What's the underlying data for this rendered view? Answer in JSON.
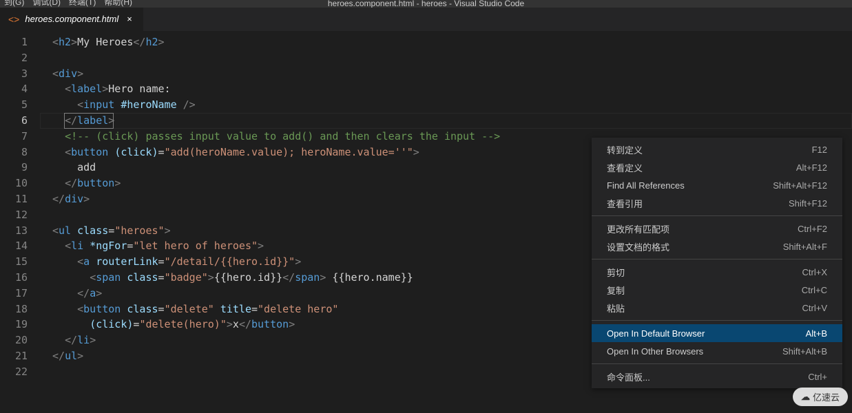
{
  "menu": {
    "m1": "到(G)",
    "m2": "调试(D)",
    "m3": "终端(T)",
    "m4": "帮助(H)"
  },
  "title": "heroes.component.html - heroes - Visual Studio Code",
  "tab": {
    "name": "heroes.component.html",
    "icon": "<>",
    "close": "×"
  },
  "lines": [
    "1",
    "2",
    "3",
    "4",
    "5",
    "6",
    "7",
    "8",
    "9",
    "10",
    "11",
    "12",
    "13",
    "14",
    "15",
    "16",
    "17",
    "18",
    "19",
    "20",
    "21",
    "22"
  ],
  "currentLine": "6",
  "code": {
    "l1_txt": "My Heroes",
    "l4_txt": "Hero name:",
    "l5_attr": "#heroName",
    "l7_c": "<!-- (click) passes input value to add() and then clears the input -->",
    "l8_ev": "(click)",
    "l8_val": "\"add(heroName.value); heroName.value=''\"",
    "l9": "add",
    "l13_a": "class",
    "l13_v": "\"heroes\"",
    "l14_a": "*ngFor",
    "l14_v": "\"let hero of heroes\"",
    "l15_a": "routerLink",
    "l15_v": "\"/detail/{{hero.id}}\"",
    "l16_a": "class",
    "l16_v": "\"badge\"",
    "l16_t1": "{{hero.id}}",
    "l16_t2": " {{hero.name}}",
    "l18_a1": "class",
    "l18_v1": "\"delete\"",
    "l18_a2": "title",
    "l18_v2": "\"delete hero\"",
    "l19_a": "(click)",
    "l19_v": "\"delete(hero)\"",
    "l19_t": "x"
  },
  "ctx": [
    {
      "l": "转到定义",
      "s": "F12"
    },
    {
      "l": "查看定义",
      "s": "Alt+F12"
    },
    {
      "l": "Find All References",
      "s": "Shift+Alt+F12"
    },
    {
      "l": "查看引用",
      "s": "Shift+F12"
    },
    {
      "sep": true
    },
    {
      "l": "更改所有匹配项",
      "s": "Ctrl+F2"
    },
    {
      "l": "设置文档的格式",
      "s": "Shift+Alt+F"
    },
    {
      "sep": true
    },
    {
      "l": "剪切",
      "s": "Ctrl+X"
    },
    {
      "l": "复制",
      "s": "Ctrl+C"
    },
    {
      "l": "粘贴",
      "s": "Ctrl+V"
    },
    {
      "sep": true
    },
    {
      "l": "Open In Default Browser",
      "s": "Alt+B",
      "sel": true
    },
    {
      "l": "Open In Other Browsers",
      "s": "Shift+Alt+B"
    },
    {
      "sep": true
    },
    {
      "l": "命令面板...",
      "s": "Ctrl+"
    }
  ],
  "watermark": {
    "icon": "☁",
    "text": "亿速云"
  }
}
